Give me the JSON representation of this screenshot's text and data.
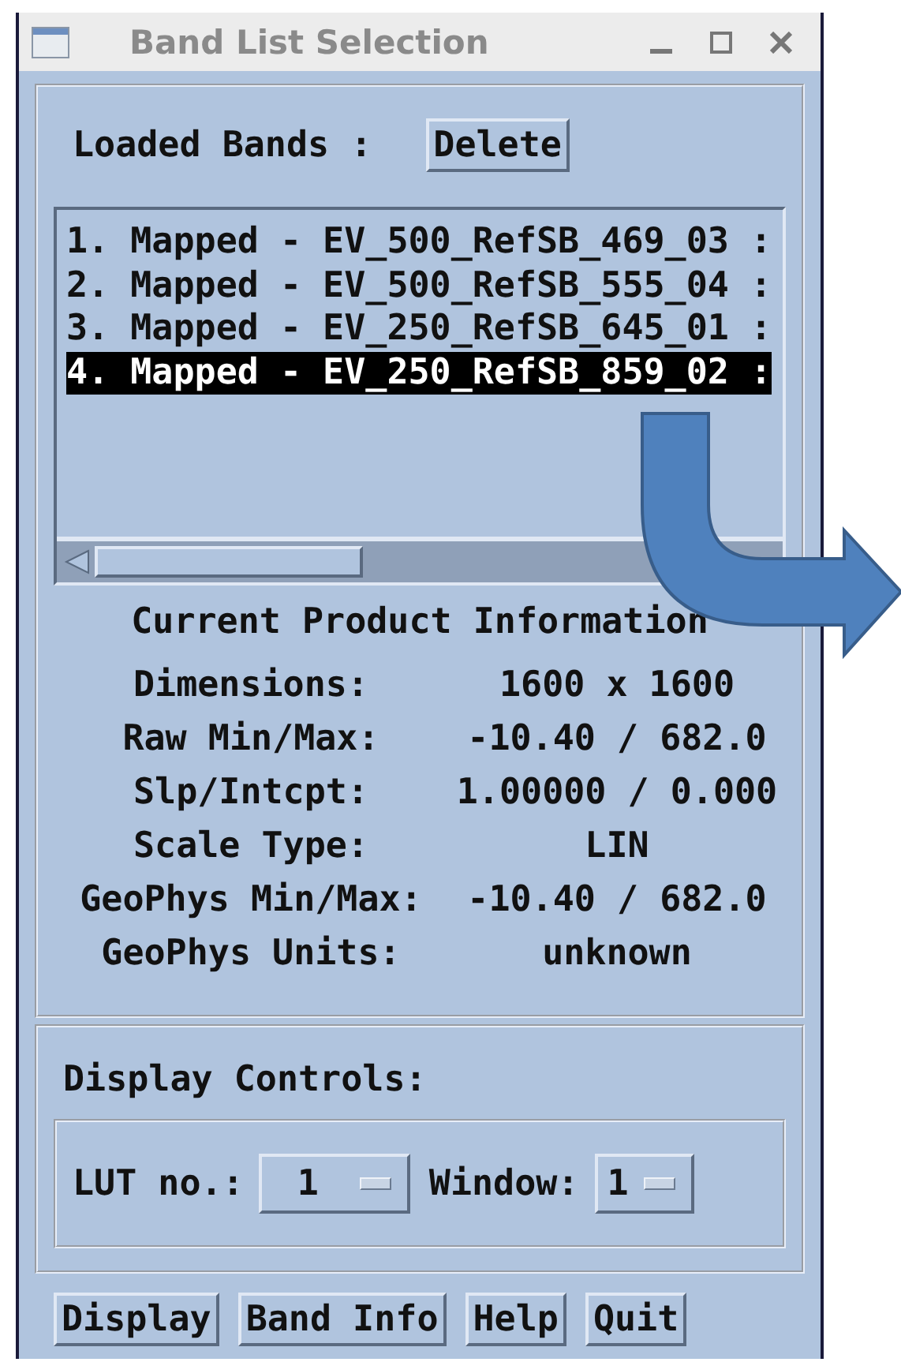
{
  "window": {
    "title": "Band List Selection"
  },
  "loaded_bands": {
    "label": "Loaded Bands :",
    "delete_button": "Delete"
  },
  "bands": [
    {
      "text": "1. Mapped - EV_500_RefSB_469_03 :",
      "selected": false
    },
    {
      "text": "2. Mapped - EV_500_RefSB_555_04 :",
      "selected": false
    },
    {
      "text": "3. Mapped - EV_250_RefSB_645_01 :",
      "selected": false
    },
    {
      "text": "4. Mapped - EV_250_RefSB_859_02 :",
      "selected": true
    }
  ],
  "product_info": {
    "title": "Current Product Information",
    "rows": [
      {
        "label": "Dimensions:",
        "value": "1600 x 1600"
      },
      {
        "label": "Raw Min/Max:",
        "value": "-10.40 / 682.0"
      },
      {
        "label": "Slp/Intcpt:",
        "value": "1.00000 / 0.000"
      },
      {
        "label": "Scale Type:",
        "value": "LIN"
      },
      {
        "label": "GeoPhys Min/Max:",
        "value": "-10.40 / 682.0"
      },
      {
        "label": "GeoPhys Units:",
        "value": "unknown"
      }
    ]
  },
  "display_controls": {
    "title": "Display Controls:",
    "lut": {
      "label": "LUT no.:",
      "value": "1"
    },
    "window_select": {
      "label": "Window:",
      "value": "1"
    }
  },
  "buttons": [
    "Display",
    "Band Info",
    "Help",
    "Quit"
  ]
}
